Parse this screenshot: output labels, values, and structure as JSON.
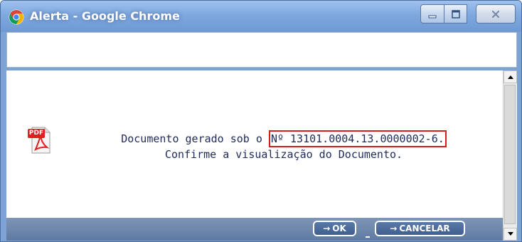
{
  "window": {
    "title": "Alerta - Google Chrome"
  },
  "titlebar_icons": {
    "app": "chrome-logo-icon",
    "minimize": "minimize-icon",
    "maximize": "maximize-icon",
    "close": "close-icon"
  },
  "alert": {
    "icon": "pdf-file-icon",
    "icon_label": "PDF",
    "message_prefix": "Documento gerado sob o",
    "document_number": "Nº 13101.0004.13.0000002-6.",
    "message_line2": "Confirme a visualização do Documento."
  },
  "actions": {
    "ok_arrow": "→",
    "ok_label": "OK",
    "cancel_arrow": "→",
    "cancel_label": "CANCELAR"
  },
  "colors": {
    "titlebar": "#7fa8df",
    "footer_bar": "#6a84aa",
    "message_text": "#1e2a5a",
    "highlight_border": "#d81b1b",
    "pdf_red": "#e01f1f"
  }
}
